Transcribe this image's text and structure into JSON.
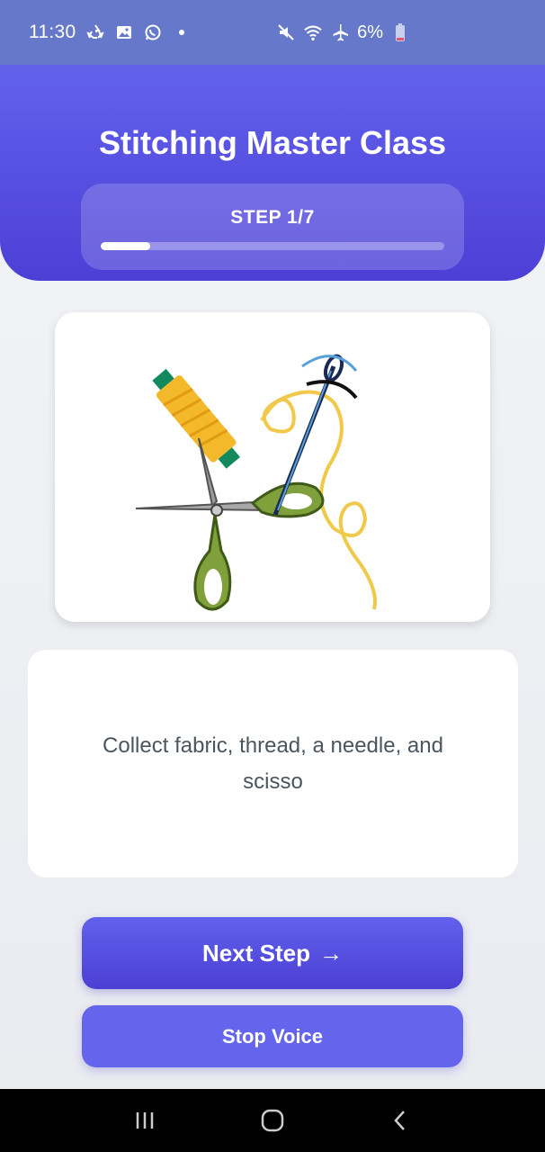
{
  "status_bar": {
    "time": "11:30",
    "battery": "6%",
    "icons_left": [
      "recycle-icon",
      "gallery-icon",
      "whatsapp-icon",
      "dot-icon"
    ],
    "icons_right": [
      "mute-icon",
      "wifi-icon",
      "airplane-icon",
      "battery-icon"
    ]
  },
  "header": {
    "title": "Stitching Master Class",
    "step_label": "STEP 1/7",
    "progress": 0.143
  },
  "image_card": {
    "icon": "sewing-tools-icon"
  },
  "instruction": {
    "text": "Collect fabric, thread, a needle, and scisso"
  },
  "buttons": {
    "next_label": "Next Step",
    "next_arrow": "→",
    "stop_label": "Stop Voice"
  },
  "nav": {
    "items": [
      "recent-apps-icon",
      "home-icon",
      "back-icon"
    ]
  },
  "colors": {
    "primary": "#5b5be8",
    "header_dark": "#4c3fd6",
    "status_bar": "#6578c9",
    "text_muted": "#4a5560"
  }
}
